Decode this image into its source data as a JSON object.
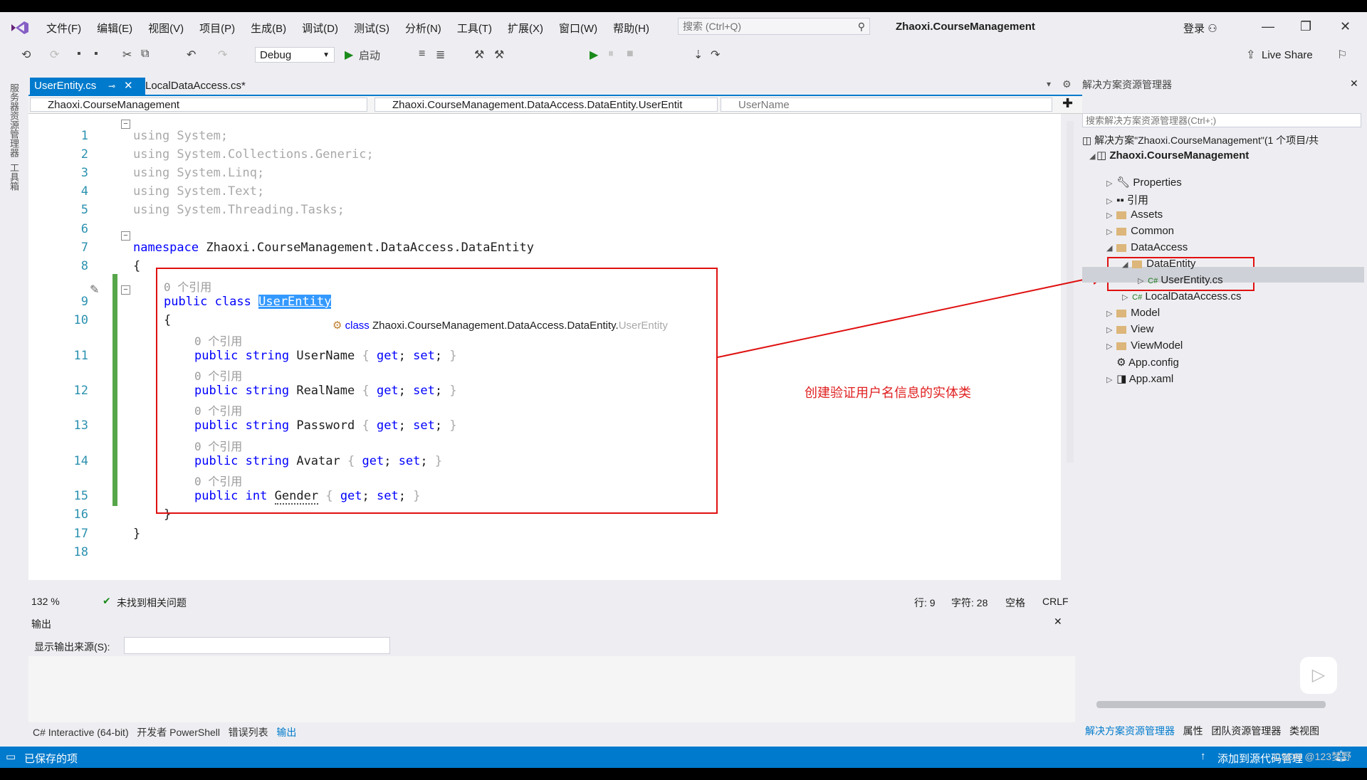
{
  "app": {
    "menu": [
      "文件(F)",
      "编辑(E)",
      "视图(V)",
      "项目(P)",
      "生成(B)",
      "调试(D)",
      "测试(S)",
      "分析(N)",
      "工具(T)",
      "扩展(X)",
      "窗口(W)",
      "帮助(H)"
    ],
    "search_placeholder": "搜索 (Ctrl+Q)",
    "solution_name": "Zhaoxi.CourseManagement",
    "login": "登录",
    "config": "Debug",
    "start_label": "启动",
    "live_share": "Live Share"
  },
  "rail": [
    "服务器资源管理器",
    "工具箱"
  ],
  "tabs": [
    {
      "label": "UserEntity.cs",
      "active": true
    },
    {
      "label": "LocalDataAccess.cs*",
      "active": false
    }
  ],
  "nav": {
    "project": "Zhaoxi.CourseManagement",
    "type": "Zhaoxi.CourseManagement.DataAccess.DataEntity.UserEntit",
    "member": "UserName"
  },
  "code": {
    "refs": "0 个引用",
    "tooltip_kw": "class",
    "tooltip_text": "Zhaoxi.CourseManagement.DataAccess.DataEntity.",
    "tooltip_tail": "UserEntity",
    "annotation": "创建验证用户名信息的实体类"
  },
  "editor_status": {
    "zoom": "132 %",
    "issues": "未找到相关问题",
    "line": "行: 9",
    "col": "字符: 28",
    "space": "空格",
    "eol": "CRLF"
  },
  "output": {
    "title": "输出",
    "source_label": "显示输出来源(S):"
  },
  "bottom_tabs": [
    "C# Interactive (64-bit)",
    "开发者 PowerShell",
    "错误列表",
    "输出"
  ],
  "solution_explorer": {
    "title": "解决方案资源管理器",
    "search": "搜索解决方案资源管理器(Ctrl+;)",
    "solution": "解决方案\"Zhaoxi.CourseManagement\"(1 个项目/共",
    "project": "Zhaoxi.CourseManagement",
    "items": [
      "Properties",
      "引用",
      "Assets",
      "Common",
      "DataAccess",
      "DataEntity",
      "UserEntity.cs",
      "LocalDataAccess.cs",
      "Model",
      "View",
      "ViewModel",
      "App.config",
      "App.xaml"
    ],
    "bottom_tabs": [
      "解决方案资源管理器",
      "属性",
      "团队资源管理器",
      "类视图"
    ]
  },
  "statusbar": {
    "saved": "已保存的项",
    "source_control": "添加到源代码管理"
  },
  "watermark": "CSDN @123梦野"
}
